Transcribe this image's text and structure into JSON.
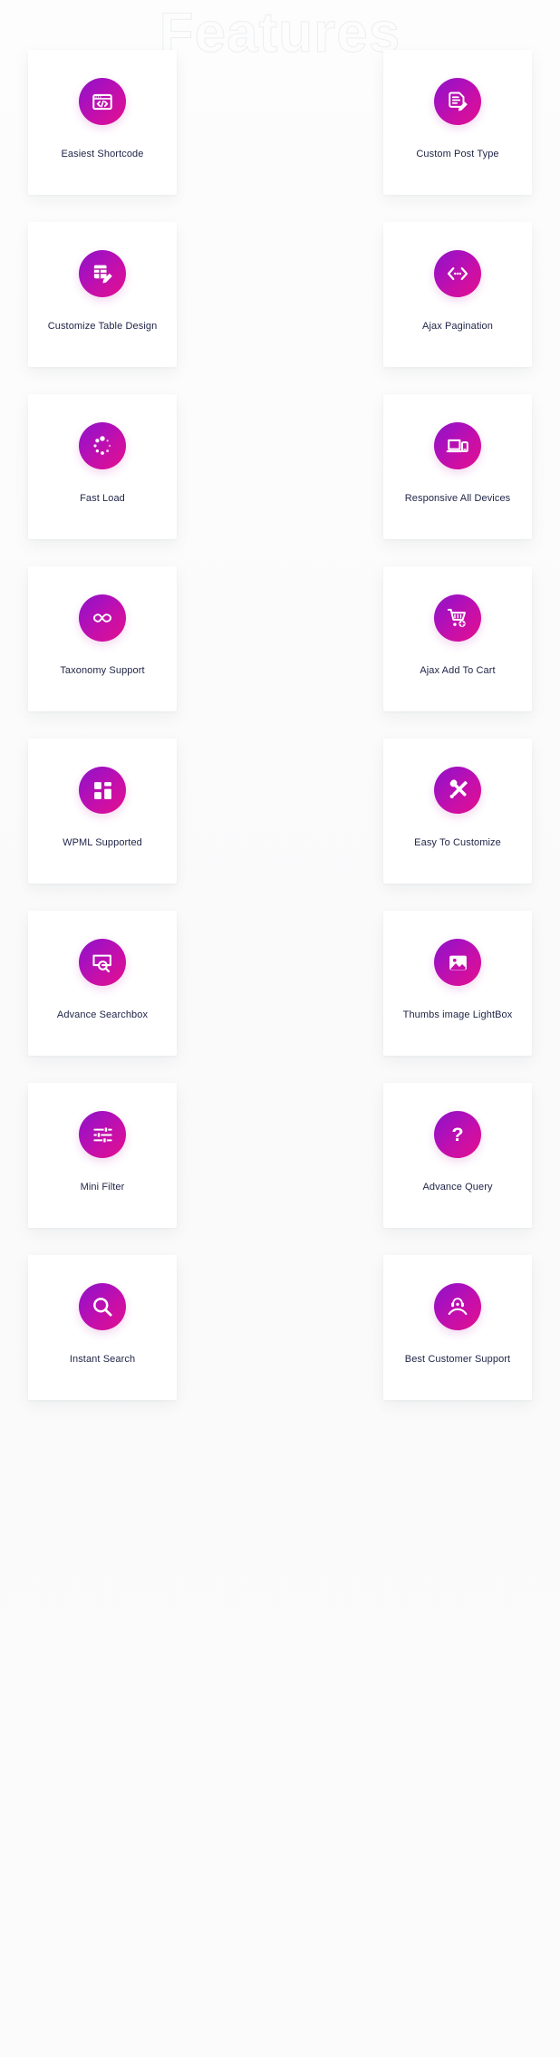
{
  "page": {
    "headline": "Features",
    "background_color": "#fbfbfc",
    "accent_gradient_from": "#8e14c4",
    "accent_gradient_to": "#e20f8d",
    "label_color": "#1e2346",
    "card_background": "#ffffff"
  },
  "features": [
    {
      "label": "Easiest Shortcode",
      "icon": "code-window-icon"
    },
    {
      "label": "Custom Post Type",
      "icon": "document-pencil-icon"
    },
    {
      "label": "Customize Table Design",
      "icon": "table-edit-icon"
    },
    {
      "label": "Ajax Pagination",
      "icon": "left-right-arrows-icon"
    },
    {
      "label": "Fast Load",
      "icon": "spinner-dots-icon"
    },
    {
      "label": "Responsive All Devices",
      "icon": "laptop-phone-icon"
    },
    {
      "label": "Taxonomy Support",
      "icon": "infinity-icon"
    },
    {
      "label": "Ajax Add To Cart",
      "icon": "cart-plus-icon"
    },
    {
      "label": "WPML Supported",
      "icon": "grid-blocks-icon"
    },
    {
      "label": "Easy To Customize",
      "icon": "wrench-pencil-icon"
    },
    {
      "label": "Advance Searchbox",
      "icon": "search-box-icon"
    },
    {
      "label": "Thumbs image LightBox",
      "icon": "image-picture-icon"
    },
    {
      "label": "Mini Filter",
      "icon": "sliders-filter-icon"
    },
    {
      "label": "Advance Query",
      "icon": "question-mark-icon"
    },
    {
      "label": "Instant Search",
      "icon": "magnifier-icon"
    },
    {
      "label": "Best Customer Support",
      "icon": "support-hand-headset-icon"
    }
  ]
}
